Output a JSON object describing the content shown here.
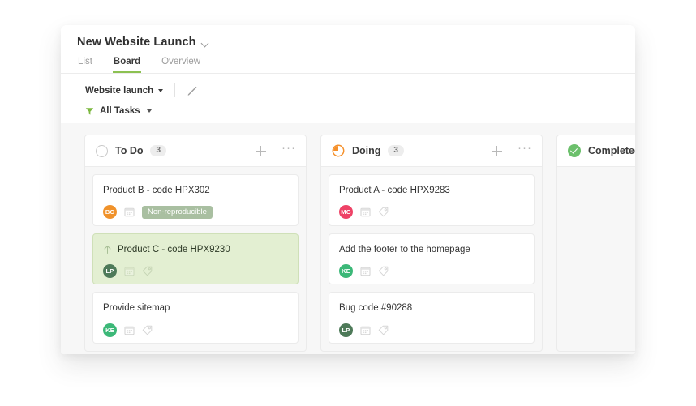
{
  "header": {
    "project_title": "New Website Launch",
    "title_chevron_icon": "chevron-down-icon",
    "tabs": [
      {
        "label": "List",
        "active": false
      },
      {
        "label": "Board",
        "active": true
      },
      {
        "label": "Overview",
        "active": false
      }
    ]
  },
  "toolbar": {
    "view_label": "Website launch",
    "view_caret_icon": "caret-down-icon",
    "edit_icon": "pencil-icon",
    "filter_icon": "funnel-icon",
    "filter_label": "All Tasks",
    "filter_caret_icon": "caret-down-icon"
  },
  "board": {
    "add_icon": "plus-icon",
    "more_icon": "ellipsis-icon",
    "columns": [
      {
        "title": "To Do",
        "count": "3",
        "status_icon": "circle-empty-icon",
        "cards": [
          {
            "title": "Product B - code HPX302",
            "highlight": false,
            "priority_icon": null,
            "avatar": {
              "initials": "BC",
              "color": "#f0922b"
            },
            "calendar_icon": "calendar-icon",
            "tag_icon": null,
            "chip": {
              "label": "Non-reproducible",
              "color": "#a9bfa1"
            }
          },
          {
            "title": "Product C - code HPX9230",
            "highlight": true,
            "priority_icon": "arrow-up-icon",
            "avatar": {
              "initials": "LP",
              "color": "#4e7a59"
            },
            "calendar_icon": "calendar-icon",
            "tag_icon": "tag-icon",
            "chip": null
          },
          {
            "title": "Provide sitemap",
            "highlight": false,
            "priority_icon": null,
            "avatar": {
              "initials": "KE",
              "color": "#3cb878"
            },
            "calendar_icon": "calendar-icon",
            "tag_icon": "tag-icon",
            "chip": null
          }
        ]
      },
      {
        "title": "Doing",
        "count": "3",
        "status_icon": "circle-progress-icon",
        "cards": [
          {
            "title": "Product A - code HPX9283",
            "highlight": false,
            "priority_icon": null,
            "avatar": {
              "initials": "MG",
              "color": "#ee4266"
            },
            "calendar_icon": "calendar-icon",
            "tag_icon": "tag-icon",
            "chip": null
          },
          {
            "title": "Add the footer to the homepage",
            "highlight": false,
            "priority_icon": null,
            "avatar": {
              "initials": "KE",
              "color": "#3cb878"
            },
            "calendar_icon": "calendar-icon",
            "tag_icon": "tag-icon",
            "chip": null
          },
          {
            "title": "Bug code #90288",
            "highlight": false,
            "priority_icon": null,
            "avatar": {
              "initials": "LP",
              "color": "#4e7a59"
            },
            "calendar_icon": "calendar-icon",
            "tag_icon": "tag-icon",
            "chip": null
          }
        ]
      },
      {
        "title": "Completed",
        "count": null,
        "status_icon": "circle-check-icon",
        "cards": []
      }
    ]
  },
  "colors": {
    "accent_green": "#8cc152",
    "doing_orange": "#f5902b",
    "done_green": "#6cc06c",
    "highlight_card": "#e3efd2",
    "board_bg": "#f7f7f7"
  }
}
